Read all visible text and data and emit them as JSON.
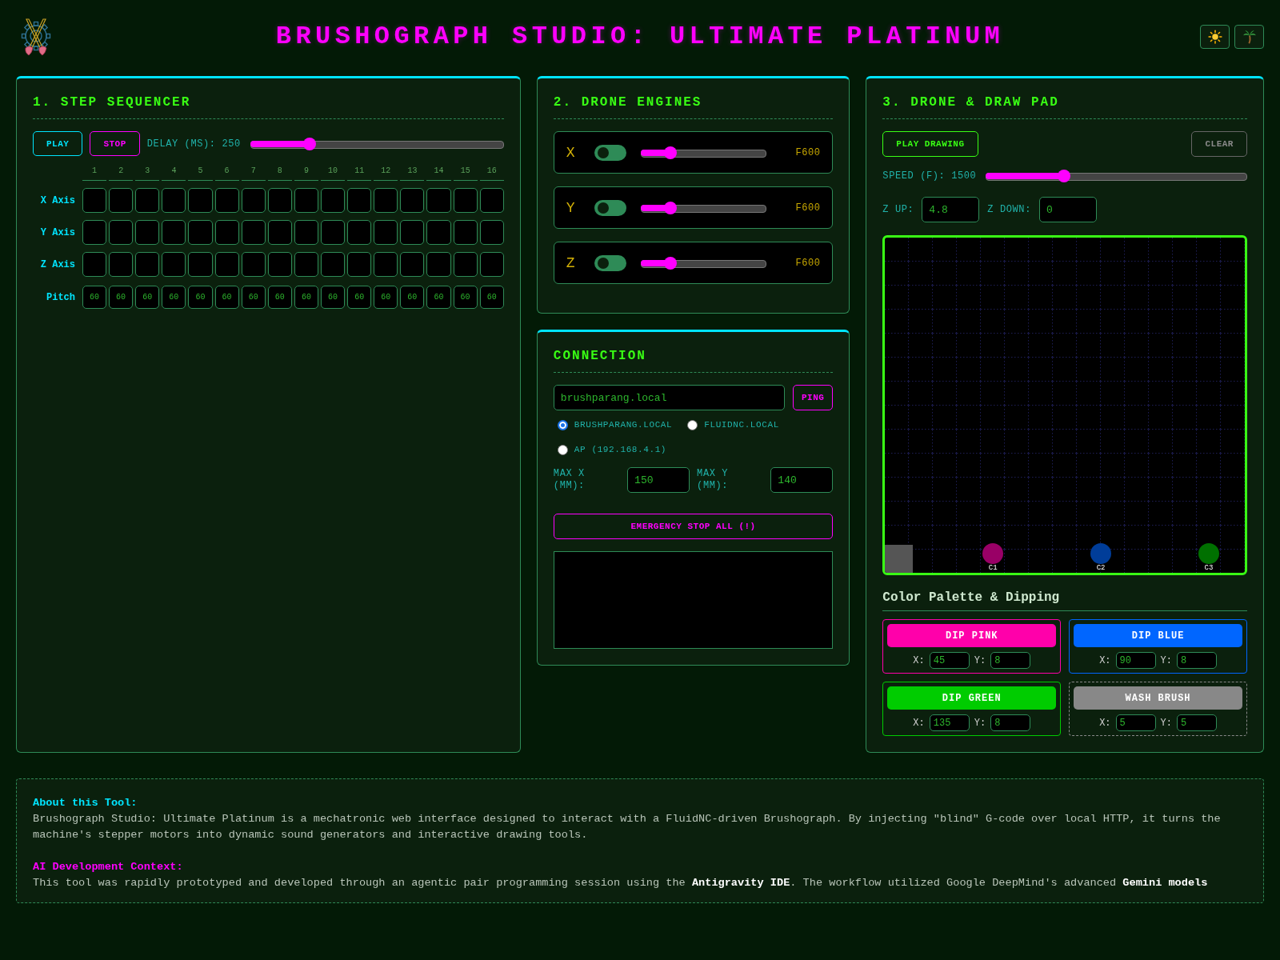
{
  "header": {
    "title": "BRUSHOGRAPH STUDIO: ULTIMATE PLATINUM",
    "buttons": [
      {
        "kind": "sun"
      },
      {
        "kind": "palm"
      }
    ]
  },
  "sequencer": {
    "title": "1. STEP SEQUENCER",
    "play": "PLAY",
    "stop": "STOP",
    "delay": {
      "label": "DELAY (MS): 250",
      "level": 0.22
    },
    "steps": [
      "1",
      "2",
      "3",
      "4",
      "5",
      "6",
      "7",
      "8",
      "9",
      "10",
      "11",
      "12",
      "13",
      "14",
      "15",
      "16"
    ],
    "rows": [
      {
        "kind": "axis",
        "label": "X Axis",
        "cells": [
          {
            "on": false
          },
          {
            "on": false
          },
          {
            "on": false
          },
          {
            "on": false
          },
          {
            "on": false
          },
          {
            "on": false
          },
          {
            "on": false
          },
          {
            "on": false
          },
          {
            "on": false
          },
          {
            "on": false
          },
          {
            "on": false
          },
          {
            "on": false
          },
          {
            "on": false
          },
          {
            "on": false
          },
          {
            "on": false
          },
          {
            "on": false
          }
        ]
      },
      {
        "kind": "axis",
        "label": "Y Axis",
        "cells": [
          {
            "on": false
          },
          {
            "on": false
          },
          {
            "on": false
          },
          {
            "on": false
          },
          {
            "on": false
          },
          {
            "on": false
          },
          {
            "on": false
          },
          {
            "on": false
          },
          {
            "on": false
          },
          {
            "on": false
          },
          {
            "on": false
          },
          {
            "on": false
          },
          {
            "on": false
          },
          {
            "on": false
          },
          {
            "on": false
          },
          {
            "on": false
          }
        ]
      },
      {
        "kind": "axis",
        "label": "Z Axis",
        "cells": [
          {
            "on": false
          },
          {
            "on": false
          },
          {
            "on": false
          },
          {
            "on": false
          },
          {
            "on": false
          },
          {
            "on": false
          },
          {
            "on": false
          },
          {
            "on": false
          },
          {
            "on": false
          },
          {
            "on": false
          },
          {
            "on": false
          },
          {
            "on": false
          },
          {
            "on": false
          },
          {
            "on": false
          },
          {
            "on": false
          },
          {
            "on": false
          }
        ]
      },
      {
        "kind": "pitch",
        "label": "Pitch",
        "cells": [
          {
            "value": "60"
          },
          {
            "value": "60"
          },
          {
            "value": "60"
          },
          {
            "value": "60"
          },
          {
            "value": "60"
          },
          {
            "value": "60"
          },
          {
            "value": "60"
          },
          {
            "value": "60"
          },
          {
            "value": "60"
          },
          {
            "value": "60"
          },
          {
            "value": "60"
          },
          {
            "value": "60"
          },
          {
            "value": "60"
          },
          {
            "value": "60"
          },
          {
            "value": "60"
          },
          {
            "value": "60"
          }
        ]
      }
    ]
  },
  "engines": {
    "title": "2. DRONE ENGINES",
    "rows": [
      {
        "axis": "X",
        "on": false,
        "level": 0.21,
        "reading": "F600"
      },
      {
        "axis": "Y",
        "on": false,
        "level": 0.21,
        "reading": "F600"
      },
      {
        "axis": "Z",
        "on": false,
        "level": 0.21,
        "reading": "F600"
      }
    ]
  },
  "connection": {
    "title": "CONNECTION",
    "host": {
      "value": "brushparang.local"
    },
    "ping": "PING",
    "targets": [
      {
        "label": "BRUSHPARANG.LOCAL",
        "selected": true
      },
      {
        "label": "FLUIDNC.LOCAL",
        "selected": false
      },
      {
        "label": "AP (192.168.4.1)",
        "selected": false
      }
    ],
    "limits": [
      {
        "label": "MAX X (MM):",
        "value": "150"
      },
      {
        "label": "MAX Y (MM):",
        "value": "140"
      }
    ],
    "emergency": "EMERGENCY STOP ALL (!)"
  },
  "draw_pad": {
    "title": "3. DRONE & DRAW PAD",
    "play": "PLAY DRAWING",
    "clear": "CLEAR",
    "speed": {
      "label": "SPEED (F): 1500",
      "level": 0.29
    },
    "z": [
      {
        "label": "Z UP:",
        "value": "4.8"
      },
      {
        "label": "Z DOWN:",
        "value": "0"
      }
    ]
  },
  "palette": {
    "title": "Color Palette & Dipping",
    "stations": [
      {
        "kind": "dip",
        "button": "DIP PINK",
        "color": "#ff00aa",
        "fields": [
          {
            "label": "X:",
            "value": "45"
          },
          {
            "label": "Y:",
            "value": "8"
          }
        ],
        "marker": {
          "label": "C1",
          "color": "#990066"
        }
      },
      {
        "kind": "dip",
        "button": "DIP BLUE",
        "color": "#0066ff",
        "fields": [
          {
            "label": "X:",
            "value": "90"
          },
          {
            "label": "Y:",
            "value": "8"
          }
        ],
        "marker": {
          "label": "C2",
          "color": "#003d99"
        }
      },
      {
        "kind": "dip",
        "button": "DIP GREEN",
        "color": "#00cc00",
        "fields": [
          {
            "label": "X:",
            "value": "135"
          },
          {
            "label": "Y:",
            "value": "8"
          }
        ],
        "marker": {
          "label": "C3",
          "color": "#007000"
        }
      },
      {
        "kind": "wash",
        "button": "WASH BRUSH",
        "color": "#888888",
        "fields": [
          {
            "label": "X:",
            "value": "5"
          },
          {
            "label": "Y:",
            "value": "5"
          }
        ],
        "marker": {
          "color": "#555555"
        }
      }
    ]
  },
  "about": {
    "sections": [
      {
        "kind": "info",
        "heading": "About this Tool:",
        "text": "Brushograph Studio: Ultimate Platinum is a mechatronic web interface designed to interact with a FluidNC-driven Brushograph. By injecting \"blind\" G-code over local HTTP, it turns the machine's stepper motors into dynamic sound generators and interactive drawing tools."
      },
      {
        "kind": "ai",
        "heading": "AI Development Context:",
        "text": "This tool was rapidly prototyped and developed through an agentic pair programming session using the **Antigravity IDE**. The workflow utilized Google DeepMind's advanced **Gemini models**"
      }
    ]
  }
}
